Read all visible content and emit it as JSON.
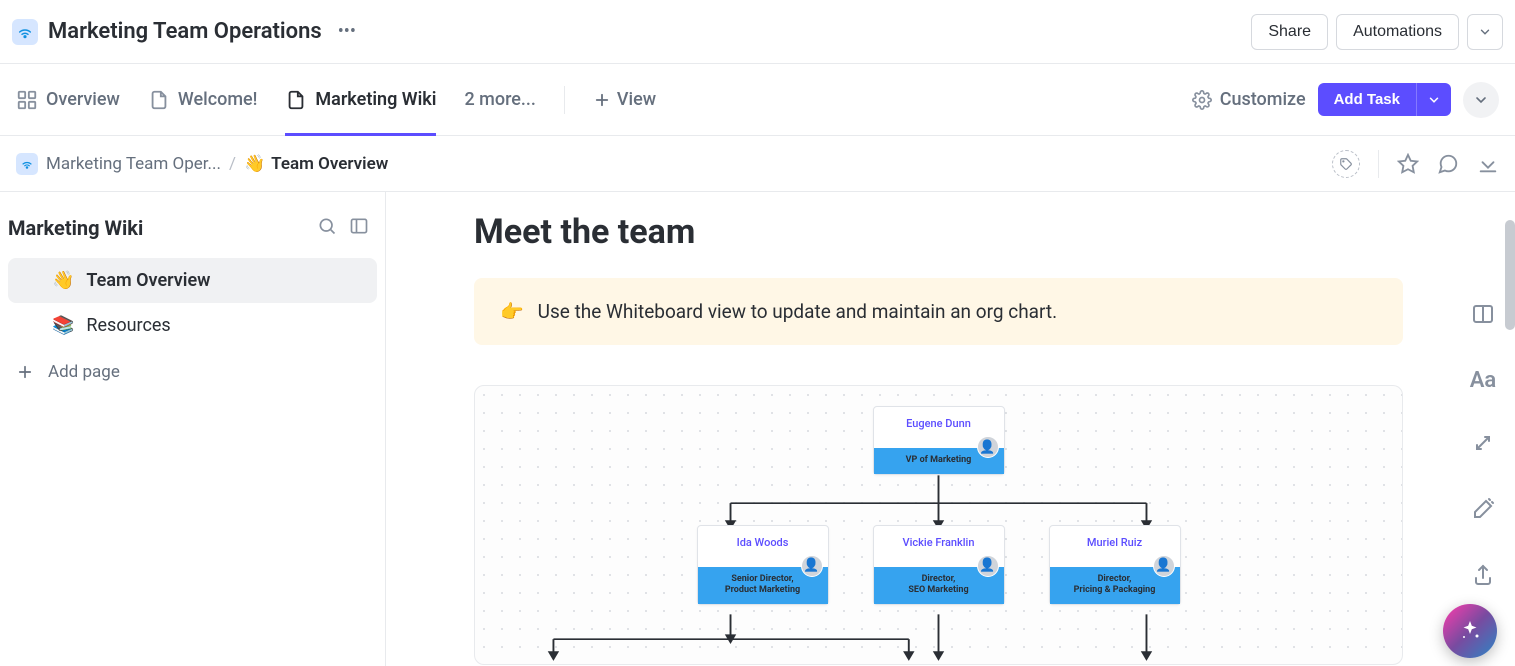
{
  "header": {
    "workspace_name": "Marketing Team Operations",
    "share_label": "Share",
    "automations_label": "Automations"
  },
  "tabs": {
    "overview": "Overview",
    "welcome": "Welcome!",
    "wiki": "Marketing Wiki",
    "more": "2 more...",
    "add_view": "View",
    "customize": "Customize",
    "add_task": "Add Task"
  },
  "breadcrumb": {
    "parent": "Marketing Team Oper...",
    "separator": "/",
    "current_emoji": "👋",
    "current": "Team Overview"
  },
  "sidebar": {
    "title": "Marketing Wiki",
    "items": [
      {
        "emoji": "👋",
        "label": "Team Overview",
        "active": true
      },
      {
        "emoji": "📚",
        "label": "Resources",
        "active": false
      }
    ],
    "add_page": "Add page"
  },
  "content": {
    "heading": "Meet the team",
    "callout_emoji": "👉",
    "callout_text": "Use the Whiteboard view to update and maintain an org chart."
  },
  "org_chart": {
    "root": {
      "name": "Eugene Dunn",
      "title": "VP of Marketing"
    },
    "children": [
      {
        "name": "Ida Woods",
        "title": "Senior Director,\nProduct Marketing"
      },
      {
        "name": "Vickie Franklin",
        "title": "Director,\nSEO Marketing"
      },
      {
        "name": "Muriel Ruiz",
        "title": "Director,\nPricing & Packaging"
      }
    ]
  }
}
